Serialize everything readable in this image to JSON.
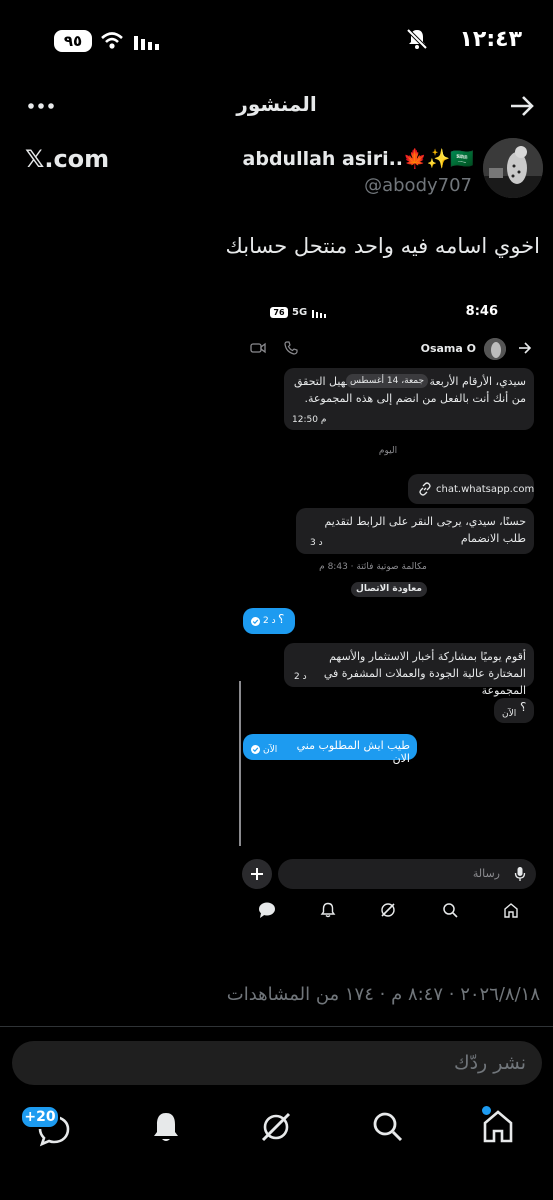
{
  "status_bar": {
    "time": "١٢:٤٣",
    "battery": "٩٥"
  },
  "header": {
    "title": "المنشور"
  },
  "post": {
    "author_name": "abdullah asiri..🍁✨🇸🇦",
    "handle": "@abody707",
    "source_label": "𝕏.com",
    "text": "اخوي اسامه فيه واحد منتحل حسابك",
    "meta": "٢٠٢٦/٨/١٨ · ٨:٤٧ م · ١٧٤ من المشاهدات"
  },
  "screenshot": {
    "status_time": "8:46",
    "battery": "76",
    "network": "5G",
    "contact_name": "Osama O",
    "msg1_text": "سيدي، الأرقام الأربعة ..ك تهدف إلى تسهيل التحقق من أنك أنت بالفعل من انضم إلى هذه المجموعة.",
    "msg1_date_chip": "جمعة، 14 أغسطس",
    "msg1_time": "12:50 م",
    "day_separator": "اليوم",
    "link_text": "chat.whatsapp.com",
    "msg2_text": "حسنًا، سيدي، يرجى النقر على الرابط لتقديم طلب الانضمام",
    "msg2_time": "3 د",
    "missed_call": "مكالمة صوتية فائتة · 8:43 م",
    "callback_button": "معاودة الاتصال",
    "out1_text": "؟",
    "out1_time": "2 د",
    "msg3_text": "أقوم يوميًا بمشاركة أخبار الاستثمار والأسهم المختارة عالية الجودة والعملات المشفرة في المجموعة",
    "msg3_time": "2 د",
    "msg4_text": "؟",
    "msg4_time": "الآن",
    "out2_text": "طيب ايش المطلوب مني الان",
    "out2_time": "الآن",
    "composer_placeholder": "رسالة"
  },
  "reply": {
    "placeholder": "نشر ردّك"
  },
  "bottom_nav": {
    "messages_badge": "+20"
  }
}
